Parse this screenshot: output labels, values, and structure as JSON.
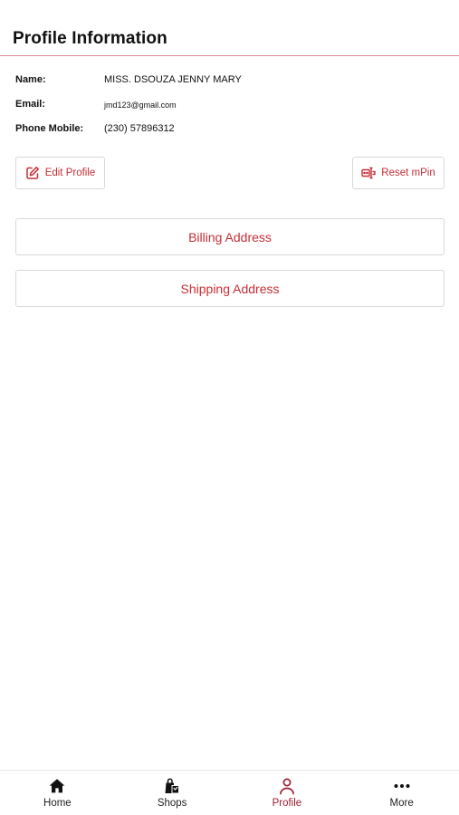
{
  "header": {
    "title": "Profile Information"
  },
  "profile": {
    "name_label": "Name:",
    "name_value": "MISS. DSOUZA JENNY MARY",
    "email_label": "Email:",
    "email_value": "jmd123@gmail.com",
    "phone_label": "Phone Mobile:",
    "phone_value": "(230) 57896312"
  },
  "actions": {
    "edit_profile": "Edit Profile",
    "edit_profile_icon": "edit-icon",
    "reset_mpin": "Reset mPin",
    "reset_mpin_icon": "password-reset-icon",
    "billing_address": "Billing Address",
    "shipping_address": "Shipping Address"
  },
  "tabbar": {
    "items": [
      {
        "label": "Home",
        "icon": "home-icon",
        "active": false
      },
      {
        "label": "Shops",
        "icon": "shopping-bags-icon",
        "active": false
      },
      {
        "label": "Profile",
        "icon": "person-icon",
        "active": true
      },
      {
        "label": "More",
        "icon": "more-dots-icon",
        "active": false
      }
    ]
  },
  "colors": {
    "accent": "#c62f36",
    "active_tab": "#9c1e31",
    "header_divider": "#d98a94",
    "button_border": "#d9d9d9"
  }
}
